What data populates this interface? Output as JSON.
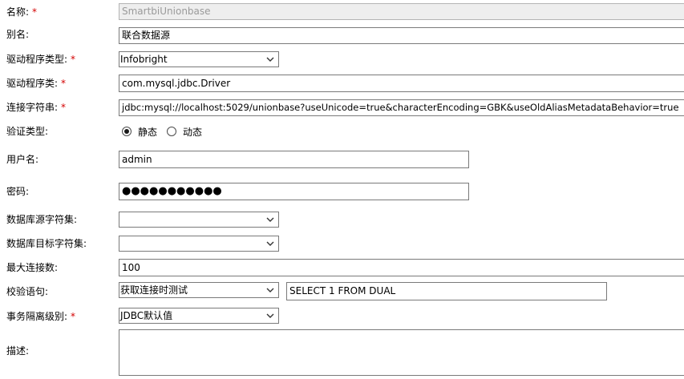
{
  "fields": {
    "name": {
      "label": "名称:",
      "required": "*",
      "value": "SmartbiUnionbase"
    },
    "alias": {
      "label": "别名:",
      "value": "联合数据源"
    },
    "driver_type": {
      "label": "驱动程序类型:",
      "required": "*",
      "value": "Infobright"
    },
    "driver_class": {
      "label": "驱动程序类:",
      "required": "*",
      "value": "com.mysql.jdbc.Driver"
    },
    "conn_string": {
      "label": "连接字符串:",
      "required": "*",
      "value": "jdbc:mysql://localhost:5029/unionbase?useUnicode=true&characterEncoding=GBK&useOldAliasMetadataBehavior=true"
    },
    "auth_type": {
      "label": "验证类型:",
      "options": [
        "静态",
        "动态"
      ],
      "selected": "静态"
    },
    "username": {
      "label": "用户名:",
      "value": "admin"
    },
    "password": {
      "label": "密码:",
      "value": "●●●●●●●●●●●"
    },
    "source_charset": {
      "label": "数据库源字符集:",
      "value": ""
    },
    "target_charset": {
      "label": "数据库目标字符集:",
      "value": ""
    },
    "max_connections": {
      "label": "最大连接数:",
      "value": "100"
    },
    "validation": {
      "label": "校验语句:",
      "mode": "获取连接时测试",
      "sql": "SELECT 1 FROM DUAL"
    },
    "isolation": {
      "label": "事务隔离级别:",
      "required": "*",
      "value": "JDBC默认值"
    },
    "description": {
      "label": "描述:",
      "value": ""
    }
  },
  "icons": {
    "select_arrow": "chevron-down-icon",
    "radio": "radio-icon"
  },
  "colors": {
    "required": "#d40000",
    "border": "#7a7a7a",
    "disabled_bg": "#eeeeee",
    "disabled_text": "#9a9a9a"
  }
}
